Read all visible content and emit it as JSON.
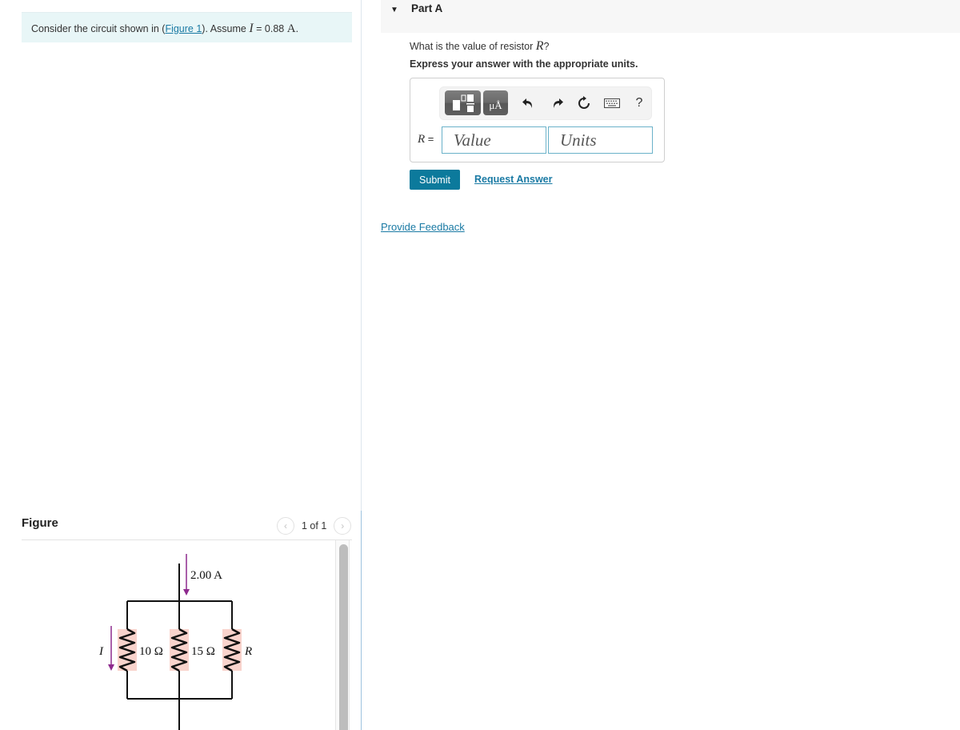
{
  "problem": {
    "intro_prefix": "Consider the circuit shown in (",
    "figure_link": "Figure 1",
    "intro_mid": "). Assume ",
    "var_symbol": "I",
    "equals": " = 0.88 ",
    "unit": "A",
    "period": "."
  },
  "figure": {
    "title": "Figure",
    "pager": {
      "prev_icon": "‹",
      "count": "1 of 1",
      "next_icon": "›"
    },
    "circuit": {
      "source_current": "2.00 A",
      "branch_current_label": "I",
      "resistors": [
        {
          "label": "10 Ω"
        },
        {
          "label": "15 Ω"
        },
        {
          "label": "R"
        }
      ],
      "colors": {
        "arrow": "#8e2a8e",
        "resistor_bg": "#f9d3cc",
        "wire": "#111111"
      }
    }
  },
  "part": {
    "title": "Part A",
    "question_prefix": "What is the value of resistor ",
    "question_var": "R",
    "question_suffix": "?",
    "instruction": "Express your answer with the appropriate units.",
    "toolbar": {
      "templates_icon": "templates-icon",
      "units_label": "μÅ",
      "undo_icon": "undo-icon",
      "redo_icon": "redo-icon",
      "reset_icon": "reset-icon",
      "keyboard_icon": "keyboard-icon",
      "help_label": "?"
    },
    "answer": {
      "var_label": "R",
      "equals": " =",
      "value_placeholder": "Value",
      "units_placeholder": "Units"
    },
    "submit_label": "Submit",
    "request_answer_label": "Request Answer"
  },
  "feedback_label": "Provide Feedback",
  "colors": {
    "accent": "#0c7a9c",
    "link": "#1a7aa4",
    "intro_bg": "#e8f6f7",
    "header_bg": "#f7f7f7"
  }
}
